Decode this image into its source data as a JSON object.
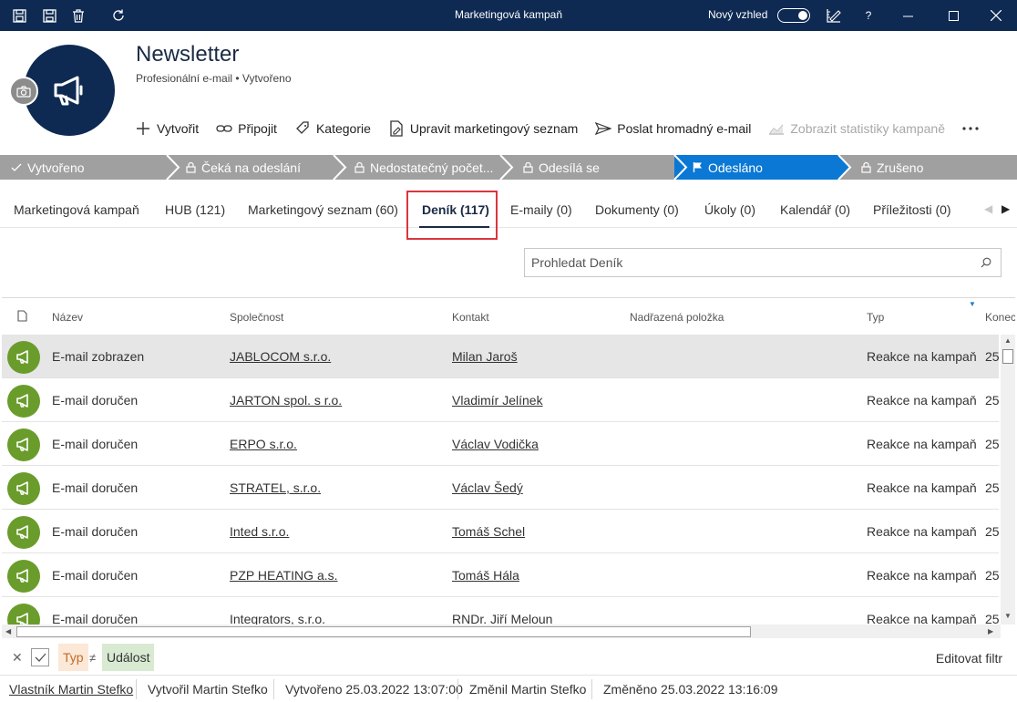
{
  "window": {
    "title": "Marketingová kampaň",
    "new_look_label": "Nový vzhled",
    "help": "?"
  },
  "record": {
    "title": "Newsletter",
    "subtitle": "Profesionální e-mail • Vytvořeno"
  },
  "commands": [
    {
      "label": "Vytvořit",
      "icon": "plus-icon"
    },
    {
      "label": "Připojit",
      "icon": "link-icon"
    },
    {
      "label": "Kategorie",
      "icon": "tag-icon"
    },
    {
      "label": "Upravit marketingový seznam",
      "icon": "edit-list-icon"
    },
    {
      "label": "Poslat hromadný e-mail",
      "icon": "send-icon"
    },
    {
      "label": "Zobrazit statistiky kampaně",
      "icon": "chart-icon",
      "disabled": true
    }
  ],
  "stages": [
    {
      "label": "Vytvořeno",
      "icon": "check"
    },
    {
      "label": "Čeká na odeslání",
      "icon": "lock"
    },
    {
      "label": "Nedostatečný počet...",
      "icon": "lock"
    },
    {
      "label": "Odesílá se",
      "icon": "lock"
    },
    {
      "label": "Odesláno",
      "icon": "flag",
      "active": true
    },
    {
      "label": "Zrušeno",
      "icon": "lock"
    }
  ],
  "tabs": [
    "Marketingová kampaň",
    "HUB (121)",
    "Marketingový seznam (60)",
    "Deník (117)",
    "E-maily (0)",
    "Dokumenty (0)",
    "Úkoly (0)",
    "Kalendář (0)",
    "Příležitosti (0)"
  ],
  "search": {
    "placeholder": "Prohledat Deník"
  },
  "grid": {
    "columns": [
      "Název",
      "Společnost",
      "Kontakt",
      "Nadřazená položka",
      "Typ",
      "Konec"
    ],
    "rows": [
      {
        "name": "E-mail zobrazen",
        "company": "JABLOCOM s.r.o.",
        "contact": "Milan Jaroš",
        "type": "Reakce na kampaň",
        "end": "25"
      },
      {
        "name": "E-mail doručen",
        "company": "JARTON spol. s r.o.",
        "contact": "Vladimír Jelínek",
        "type": "Reakce na kampaň",
        "end": "25"
      },
      {
        "name": "E-mail doručen",
        "company": "ERPO s.r.o.",
        "contact": "Václav Vodička",
        "type": "Reakce na kampaň",
        "end": "25"
      },
      {
        "name": "E-mail doručen",
        "company": "STRATEL, s.r.o.",
        "contact": "Václav Šedý",
        "type": "Reakce na kampaň",
        "end": "25"
      },
      {
        "name": "E-mail doručen",
        "company": "Inted s.r.o.",
        "contact": "Tomáš Schel",
        "type": "Reakce na kampaň",
        "end": "25"
      },
      {
        "name": "E-mail doručen",
        "company": "PZP HEATING a.s.",
        "contact": "Tomáš Hála",
        "type": "Reakce na kampaň",
        "end": "25"
      },
      {
        "name": "E-mail doručen",
        "company": "Integrators, s.r.o.",
        "contact": "RNDr. Jiří Meloun",
        "type": "Reakce na kampaň",
        "end": "25"
      }
    ]
  },
  "filter": {
    "field": "Typ",
    "operator": "≠",
    "value": "Událost",
    "edit_label": "Editovat filtr"
  },
  "footer": {
    "owner": "Vlastník Martin Stefko",
    "created_by": "Vytvořil Martin Stefko",
    "created": "Vytvořeno 25.03.2022 13:07:00",
    "modified_by": "Změnil Martin Stefko",
    "modified": "Změněno 25.03.2022 13:16:09"
  },
  "colors": {
    "titlebar": "#0e2a52",
    "stage_active": "#0a78d4",
    "stage_inactive": "#a0a0a0",
    "row_icon": "#6a9c2c",
    "highlight": "#d9363e"
  }
}
